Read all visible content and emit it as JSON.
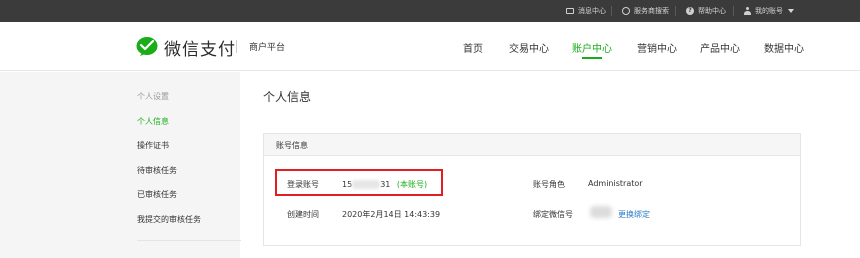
{
  "topbar": {
    "messages": "消息中心",
    "provider_search": "服务商搜索",
    "help": "帮助中心",
    "account": "我的账号"
  },
  "header": {
    "brand": "微信支付",
    "platform": "商户平台",
    "nav": [
      {
        "label": "首页"
      },
      {
        "label": "交易中心"
      },
      {
        "label": "账户中心"
      },
      {
        "label": "营销中心"
      },
      {
        "label": "产品中心"
      },
      {
        "label": "数据中心"
      }
    ],
    "active_nav": "账户中心"
  },
  "sidebar": {
    "section_title": "个人设置",
    "items": [
      {
        "label": "个人信息"
      },
      {
        "label": "操作证书"
      },
      {
        "label": "待审核任务"
      },
      {
        "label": "已审核任务"
      },
      {
        "label": "我提交的审核任务"
      }
    ],
    "active_item": "个人信息"
  },
  "main": {
    "title": "个人信息",
    "card_title": "账号信息",
    "login_account_label": "登录账号",
    "login_account_prefix": "15",
    "login_account_suffix": "31",
    "login_account_tag": "(本账号)",
    "created_label": "创建时间",
    "created_value": "2020年2月14日 14:43:39",
    "role_label": "账号角色",
    "role_value": "Administrator",
    "wechat_label": "绑定微信号",
    "change_binding": "更换绑定"
  },
  "colors": {
    "accent": "#1aad19",
    "topbar": "#3b3b3b",
    "link": "#2a7cc7",
    "highlight_box": "#e02020"
  }
}
